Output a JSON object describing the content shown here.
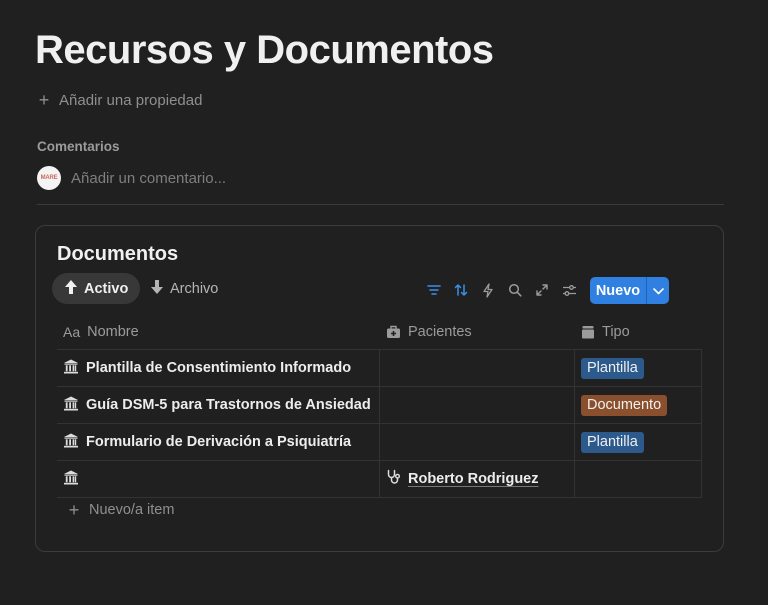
{
  "page": {
    "title": "Recursos y Documentos",
    "add_property": "Añadir una propiedad"
  },
  "comments": {
    "label": "Comentarios",
    "avatar_text": "MARE",
    "placeholder": "Añadir un comentario..."
  },
  "database": {
    "title": "Documentos",
    "views": [
      {
        "label": "Activo",
        "icon": "arrow-up-icon",
        "active": true
      },
      {
        "label": "Archivo",
        "icon": "arrow-down-icon",
        "active": false
      }
    ],
    "toolbar_icons": [
      "filter-icon",
      "sort-icon",
      "automation-icon",
      "search-icon",
      "expand-icon",
      "settings-icon"
    ],
    "new_button": "Nuevo",
    "columns": [
      {
        "label": "Nombre",
        "icon": "text-property-icon"
      },
      {
        "label": "Pacientes",
        "icon": "medkit-icon"
      },
      {
        "label": "Tipo",
        "icon": "archive-icon"
      }
    ],
    "rows": [
      {
        "name": "Plantilla de Consentimiento Informado",
        "patient": "",
        "tipo": "Plantilla",
        "tipo_color": "#2d5a8c"
      },
      {
        "name": "Guía DSM-5 para Trastornos de Ansiedad",
        "patient": "",
        "tipo": "Documento",
        "tipo_color": "#8a4f2c"
      },
      {
        "name": "Formulario de Derivación a Psiquiatría",
        "patient": "",
        "tipo": "Plantilla",
        "tipo_color": "#2d5a8c"
      },
      {
        "name": "",
        "patient": "Roberto Rodriguez",
        "tipo": "",
        "tipo_color": ""
      }
    ],
    "new_item": "Nuevo/a item"
  },
  "colors": {
    "accent": "#2f80e0",
    "background": "#202020"
  }
}
